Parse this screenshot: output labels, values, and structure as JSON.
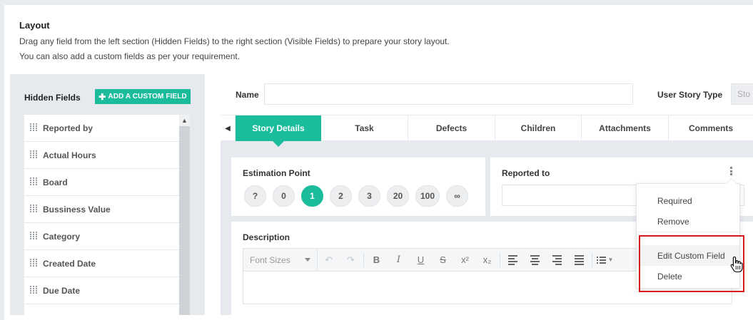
{
  "layout": {
    "title": "Layout",
    "description_line1": "Drag any field from the left section (Hidden Fields) to the right section (Visible Fields) to prepare your story layout.",
    "description_line2": "You can also add a custom fields as per your requirement."
  },
  "hidden_fields": {
    "title": "Hidden Fields",
    "add_button_label": "ADD A CUSTOM FIELD",
    "items": [
      {
        "label": "Reported by"
      },
      {
        "label": "Actual Hours"
      },
      {
        "label": "Board"
      },
      {
        "label": "Bussiness Value"
      },
      {
        "label": "Category"
      },
      {
        "label": "Created Date"
      },
      {
        "label": "Due Date"
      }
    ]
  },
  "form": {
    "name_label": "Name",
    "name_value": "",
    "type_label": "User Story Type",
    "type_value": "Sto"
  },
  "tabs": [
    {
      "label": "Story Details",
      "active": true
    },
    {
      "label": "Task",
      "active": false
    },
    {
      "label": "Defects",
      "active": false
    },
    {
      "label": "Children",
      "active": false
    },
    {
      "label": "Attachments",
      "active": false
    },
    {
      "label": "Comments",
      "active": false
    }
  ],
  "estimation": {
    "title": "Estimation Point",
    "points": [
      "?",
      "0",
      "1",
      "2",
      "3",
      "20",
      "100",
      "∞"
    ],
    "selected": "1"
  },
  "reported_to": {
    "title": "Reported to",
    "value": ""
  },
  "description": {
    "title": "Description",
    "font_sizes_label": "Font Sizes"
  },
  "context_menu": {
    "items": [
      "Required",
      "Remove",
      "Edit Custom Field",
      "Delete"
    ],
    "highlighted": "Edit Custom Field"
  },
  "colors": {
    "accent": "#1abc9c",
    "highlight_box": "#d9191b"
  }
}
